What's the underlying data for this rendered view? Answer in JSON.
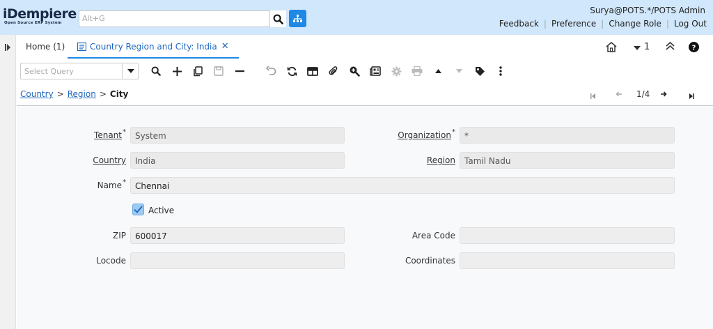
{
  "header": {
    "logo_main": "iDempiere",
    "logo_sub": "Open Source ERP System",
    "search_placeholder": "Alt+G",
    "user": "Surya@POTS.*/POTS Admin",
    "links": [
      "Feedback",
      "Preference",
      "Change Role",
      "Log Out"
    ]
  },
  "tabs": {
    "home": "Home (1)",
    "active": "Country Region and City: India",
    "window_count": "1"
  },
  "toolbar": {
    "query_placeholder": "Select Query"
  },
  "breadcrumb": {
    "items": [
      "Country",
      "Region"
    ],
    "current": "City",
    "record_position": "1/4"
  },
  "form": {
    "tenant": {
      "label": "Tenant",
      "value": "System"
    },
    "organization": {
      "label": "Organization",
      "value": "*"
    },
    "country": {
      "label": "Country",
      "value": "India"
    },
    "region": {
      "label": "Region",
      "value": "Tamil Nadu"
    },
    "name": {
      "label": "Name",
      "value": "Chennai"
    },
    "active": {
      "label": "Active",
      "checked": true
    },
    "zip": {
      "label": "ZIP",
      "value": "600017"
    },
    "area_code": {
      "label": "Area Code",
      "value": ""
    },
    "locode": {
      "label": "Locode",
      "value": ""
    },
    "coordinates": {
      "label": "Coordinates",
      "value": ""
    },
    "required_mark": "*"
  },
  "colors": {
    "header_bg": "#d1e7fb",
    "accent": "#1e88e5",
    "link": "#1e66c0"
  }
}
